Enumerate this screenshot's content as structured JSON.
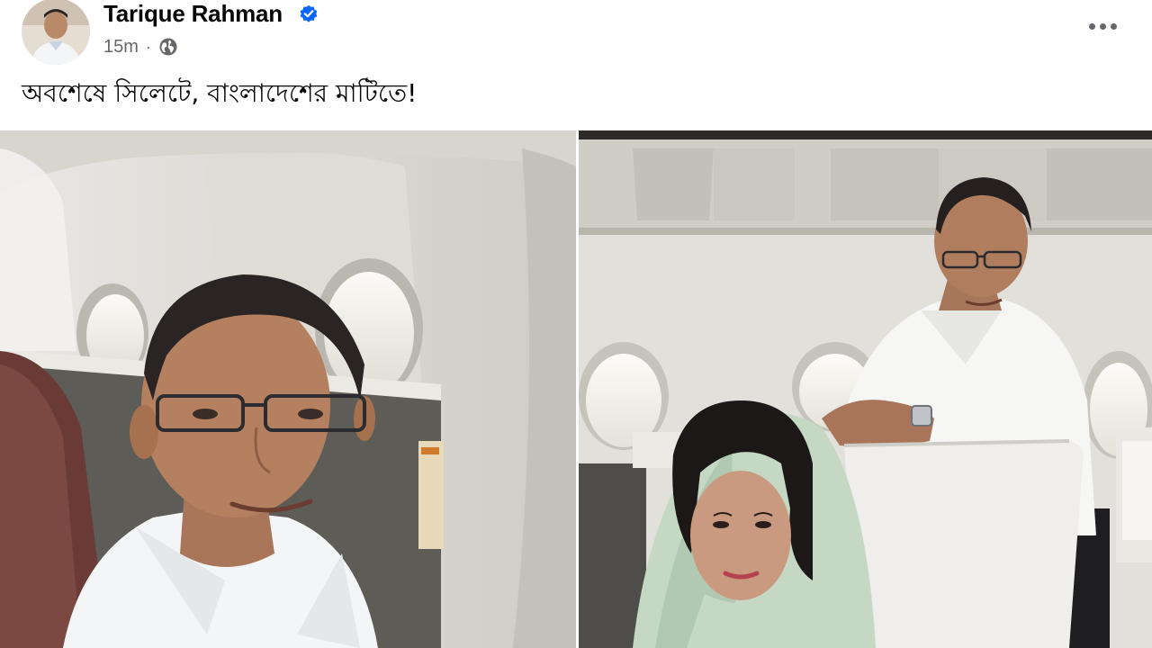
{
  "post": {
    "author_name": "Tarique Rahman",
    "timestamp": "15m",
    "separator": "·",
    "audience_icon": "globe-icon",
    "verified_icon": "verified-badge-icon",
    "text": "অবশেষে সিলেটে, বাংলাদেশের মাটিতে!",
    "more_icon": "more-options-icon",
    "photos": [
      {
        "id": "photo-1",
        "description_icon": "photo"
      },
      {
        "id": "photo-2",
        "description_icon": "photo"
      }
    ]
  },
  "colors": {
    "text_primary": "#050505",
    "text_secondary": "#65676b",
    "verified_blue": "#0866ff"
  }
}
